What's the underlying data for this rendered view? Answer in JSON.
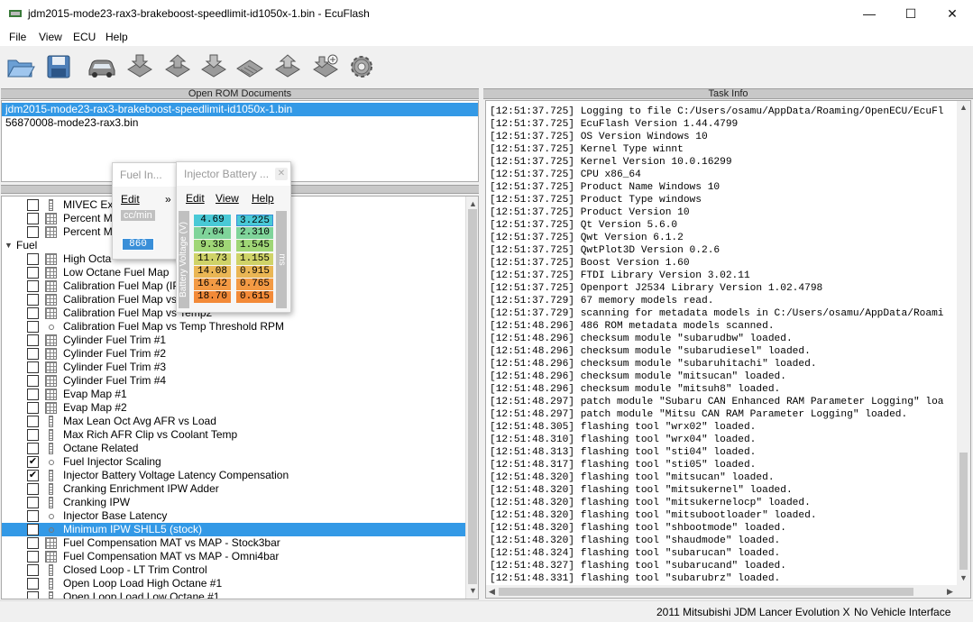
{
  "window": {
    "title": "jdm2015-mode23-rax3-brakeboost-speedlimit-id1050x-1.bin - EcuFlash",
    "minimize": "—",
    "maximize": "☐",
    "close": "✕"
  },
  "menu": [
    "File",
    "View",
    "ECU",
    "Help"
  ],
  "toolbar": [
    "open-folder-icon",
    "save-disk-icon",
    "car-icon",
    "chip-read-icon",
    "chip-write-icon",
    "chip-test-icon",
    "chip-icon",
    "chip-upload-icon",
    "chip-compare-icon",
    "settings-gear-icon"
  ],
  "open_rom": {
    "header": "Open ROM Documents",
    "items": [
      "jdm2015-mode23-rax3-brakeboost-speedlimit-id1050x-1.bin",
      "56870008-mode23-rax3.bin"
    ]
  },
  "task_info": {
    "header": "Task Info",
    "lines": [
      "[12:51:37.725] Logging to file C:/Users/osamu/AppData/Roaming/OpenECU/EcuFl",
      "[12:51:37.725] EcuFlash Version 1.44.4799",
      "[12:51:37.725] OS Version Windows 10",
      "[12:51:37.725] Kernel Type winnt",
      "[12:51:37.725] Kernel Version 10.0.16299",
      "[12:51:37.725] CPU x86_64",
      "[12:51:37.725] Product Name Windows 10",
      "[12:51:37.725] Product Type windows",
      "[12:51:37.725] Product Version 10",
      "[12:51:37.725] Qt Version 5.6.0",
      "[12:51:37.725] Qwt Version 6.1.2",
      "[12:51:37.725] QwtPlot3D Version 0.2.6",
      "[12:51:37.725] Boost Version 1.60",
      "[12:51:37.725] FTDI Library Version 3.02.11",
      "[12:51:37.725] Openport J2534 Library Version 1.02.4798",
      "[12:51:37.729] 67 memory models read.",
      "[12:51:37.729] scanning for metadata models in C:/Users/osamu/AppData/Roami",
      "[12:51:48.296] 486 ROM metadata models scanned.",
      "[12:51:48.296] checksum module \"subarudbw\" loaded.",
      "[12:51:48.296] checksum module \"subarudiesel\" loaded.",
      "[12:51:48.296] checksum module \"subaruhitachi\" loaded.",
      "[12:51:48.296] checksum module \"mitsucan\" loaded.",
      "[12:51:48.296] checksum module \"mitsuh8\" loaded.",
      "[12:51:48.297] patch module \"Subaru CAN Enhanced RAM Parameter Logging\" loa",
      "[12:51:48.297] patch module \"Mitsu CAN RAM Parameter Logging\" loaded.",
      "[12:51:48.305] flashing tool \"wrx02\" loaded.",
      "[12:51:48.310] flashing tool \"wrx04\" loaded.",
      "[12:51:48.313] flashing tool \"sti04\" loaded.",
      "[12:51:48.317] flashing tool \"sti05\" loaded.",
      "[12:51:48.320] flashing tool \"mitsucan\" loaded.",
      "[12:51:48.320] flashing tool \"mitsukernel\" loaded.",
      "[12:51:48.320] flashing tool \"mitsukernelocp\" loaded.",
      "[12:51:48.320] flashing tool \"mitsubootloader\" loaded.",
      "[12:51:48.320] flashing tool \"shbootmode\" loaded.",
      "[12:51:48.320] flashing tool \"shaudmode\" loaded.",
      "[12:51:48.324] flashing tool \"subarucan\" loaded.",
      "[12:51:48.327] flashing tool \"subarucand\" loaded.",
      "[12:51:48.331] flashing tool \"subarubrz\" loaded."
    ]
  },
  "tree": [
    {
      "label": "MIVEC Exh",
      "icon": "col",
      "check": ""
    },
    {
      "label": "Percent M",
      "icon": "grid",
      "check": ""
    },
    {
      "label": "Percent M",
      "icon": "grid",
      "check": ""
    },
    {
      "label": "Fuel",
      "icon": "",
      "check": "",
      "group": true
    },
    {
      "label": "High Octa",
      "icon": "grid",
      "check": ""
    },
    {
      "label": "Low Octane Fuel Map",
      "icon": "grid",
      "check": ""
    },
    {
      "label": "Calibration Fuel Map (IP",
      "icon": "grid",
      "check": ""
    },
    {
      "label": "Calibration Fuel Map vs T",
      "icon": "grid",
      "check": ""
    },
    {
      "label": "Calibration Fuel Map vs Temp2",
      "icon": "grid",
      "check": ""
    },
    {
      "label": "Calibration Fuel Map vs Temp Threshold RPM",
      "icon": "dot",
      "check": ""
    },
    {
      "label": "Cylinder Fuel Trim #1",
      "icon": "grid",
      "check": ""
    },
    {
      "label": "Cylinder Fuel Trim #2",
      "icon": "grid",
      "check": ""
    },
    {
      "label": "Cylinder Fuel Trim #3",
      "icon": "grid",
      "check": ""
    },
    {
      "label": "Cylinder Fuel Trim #4",
      "icon": "grid",
      "check": ""
    },
    {
      "label": "Evap Map #1",
      "icon": "grid",
      "check": ""
    },
    {
      "label": "Evap Map #2",
      "icon": "grid",
      "check": ""
    },
    {
      "label": "Max Lean Oct Avg AFR vs Load",
      "icon": "col",
      "check": ""
    },
    {
      "label": "Max Rich AFR Clip vs Coolant Temp",
      "icon": "col",
      "check": ""
    },
    {
      "label": "Octane Related",
      "icon": "col",
      "check": ""
    },
    {
      "label": "Fuel Injector Scaling",
      "icon": "dot",
      "check": "✔"
    },
    {
      "label": "Injector Battery Voltage Latency Compensation",
      "icon": "col",
      "check": "✔"
    },
    {
      "label": "Cranking Enrichment IPW Adder",
      "icon": "col",
      "check": ""
    },
    {
      "label": "Cranking IPW",
      "icon": "col",
      "check": ""
    },
    {
      "label": "Injector Base Latency",
      "icon": "dot",
      "check": ""
    },
    {
      "label": "Minimum IPW SHLL5 (stock)",
      "icon": "dot",
      "check": "",
      "selected": true
    },
    {
      "label": "Fuel Compensation MAT vs MAP - Stock3bar",
      "icon": "grid",
      "check": ""
    },
    {
      "label": "Fuel Compensation MAT vs MAP - Omni4bar",
      "icon": "grid",
      "check": ""
    },
    {
      "label": "Closed Loop - LT Trim Control",
      "icon": "col",
      "check": ""
    },
    {
      "label": "Open Loop Load High Octane #1",
      "icon": "col",
      "check": ""
    },
    {
      "label": "Open Loop Load Low Octane #1",
      "icon": "col",
      "check": ""
    }
  ],
  "fuel_injector_window": {
    "title": "Fuel In...",
    "menu": [
      "Edit",
      "»"
    ],
    "unit": "cc/min",
    "value": "860"
  },
  "battery_window": {
    "title": "Injector Battery ...",
    "menu": [
      "Edit",
      "View",
      "Help"
    ],
    "axis_label": "Battery Voltage (V)",
    "unit": "ms",
    "voltages": [
      "4.69",
      "7.04",
      "9.38",
      "11.73",
      "14.08",
      "16.42",
      "18.70"
    ],
    "latencies": [
      "3.225",
      "2.310",
      "1.545",
      "1.155",
      "0.915",
      "0.765",
      "0.615"
    ],
    "colors": [
      "#49c9d6",
      "#7fd49a",
      "#9fd676",
      "#cfd368",
      "#eab654",
      "#f39a44",
      "#f38a38"
    ]
  },
  "status": {
    "vehicle": "2011 Mitsubishi JDM Lancer Evolution X",
    "interface": "No Vehicle Interface"
  }
}
